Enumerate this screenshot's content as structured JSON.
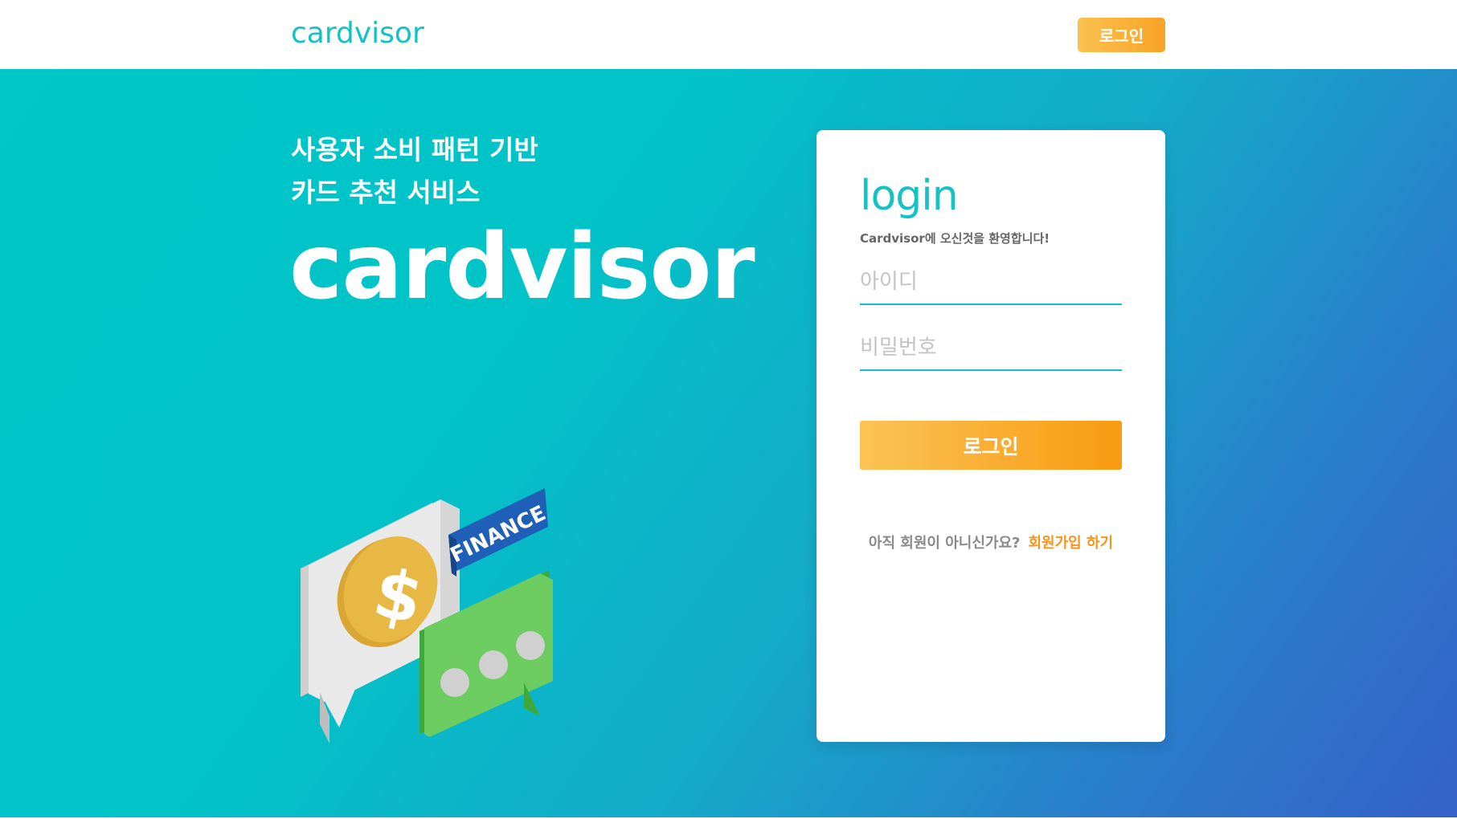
{
  "header": {
    "logo_text": "cardvisor",
    "login_label": "로그인"
  },
  "hero": {
    "tagline_line1": "사용자 소비 패턴 기반",
    "tagline_line2": "카드 추천 서비스",
    "logo_text": "cardvisor",
    "illustration_label": "FINANCE",
    "coin_symbol": "$"
  },
  "login_card": {
    "title": "login",
    "subtitle": "Cardvisor에 오신것을 환영합니다!",
    "id_placeholder": "아이디",
    "password_placeholder": "비밀번호",
    "login_button_label": "로그인",
    "signup_question": "아직 회원이 아니신가요?",
    "signup_link": "회원가입 하기"
  },
  "colors": {
    "brand_teal": "#12c2c6",
    "accent_orange": "#f8a326",
    "gradient_end_blue": "#3561c9"
  }
}
